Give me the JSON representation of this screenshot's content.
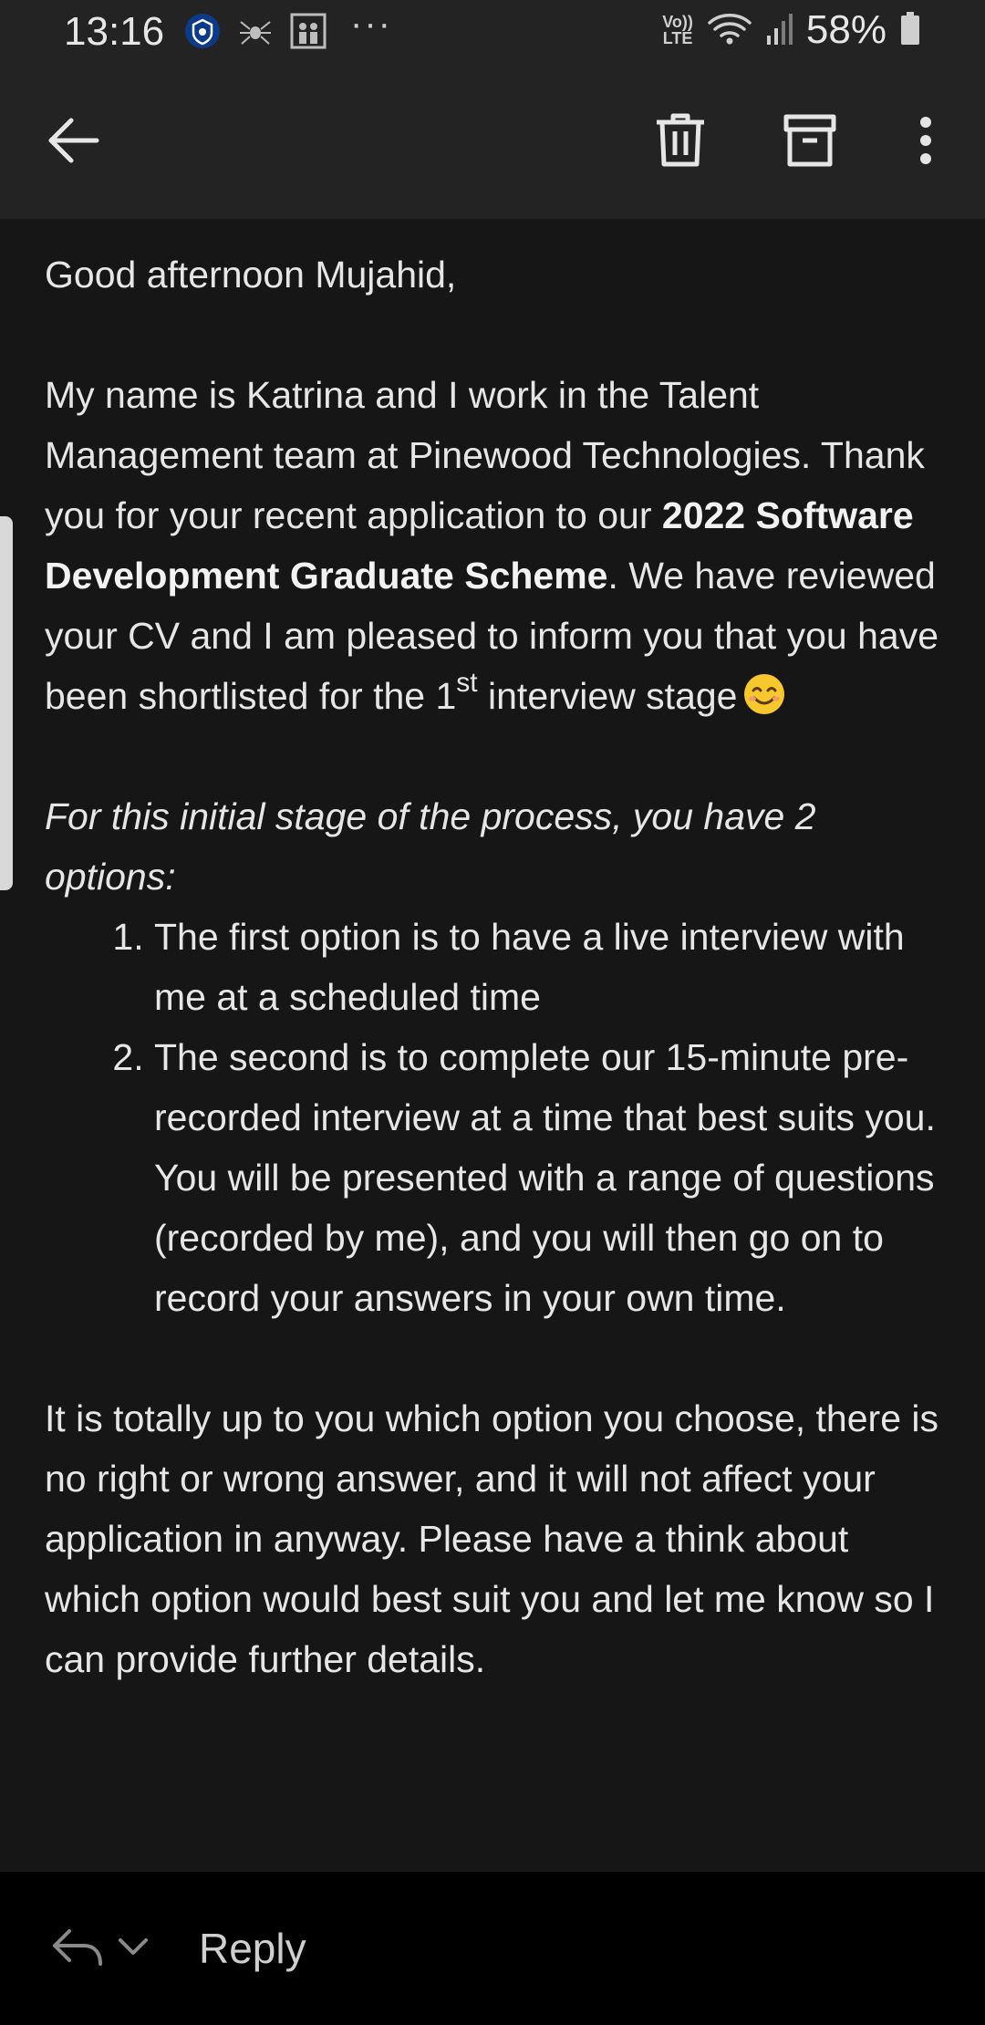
{
  "status_bar": {
    "time": "13:16",
    "volte_line1": "Vo))",
    "volte_line2": "LTE",
    "battery": "58%",
    "more_dots": "···",
    "notification_icons": [
      "crypto-shield-icon",
      "spider-icon",
      "people-icon"
    ]
  },
  "toolbar": {
    "back_icon": "back-arrow-icon",
    "delete_icon": "trash-icon",
    "archive_icon": "archive-icon",
    "more_icon": "more-vert-icon"
  },
  "email": {
    "greeting": "Good afternoon Mujahid,",
    "para1_part1": "My name is Katrina and I work in the Talent Management team at Pinewood Technologies. Thank you for your recent application to our ",
    "para1_bold": "2022 Software Development Graduate Scheme",
    "para1_part2": ". We have reviewed your CV and I am pleased to inform you that you have been shortlisted for the 1",
    "para1_sup": "st",
    "para1_part3": " interview stage",
    "para1_emoji": "smiling-face-emoji",
    "options_intro": "For this initial stage of the process, you have 2 options:",
    "options": [
      "The first option is to have a live interview with me at a scheduled time",
      "The second is to complete our 15-minute pre-recorded interview at a time that best suits you. You will be presented with a range of questions (recorded by me), and you will then go on to record your answers in your own time."
    ],
    "closing": "It is totally up to you which option you choose, there is no right or wrong answer, and it will not affect your application in anyway. Please have a think about which option would best suit you and let me know so I can provide further details."
  },
  "reply_bar": {
    "reply_label": "Reply",
    "reply_icon": "reply-arrow-icon",
    "dropdown_icon": "chevron-down-icon"
  },
  "colors": {
    "background": "#161616",
    "bar": "#232323",
    "reply_bar": "#000000",
    "text": "#e6e6e6"
  }
}
